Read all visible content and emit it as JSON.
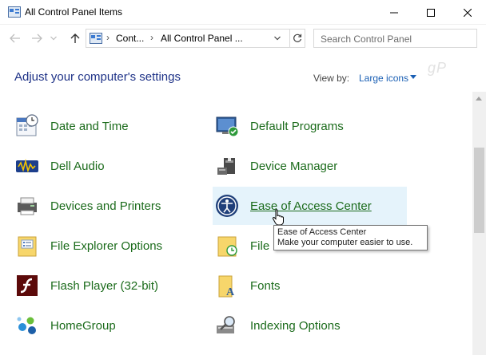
{
  "window": {
    "title": "All Control Panel Items",
    "controls": [
      "minimize",
      "maximize",
      "close"
    ]
  },
  "nav": {
    "address_crumbs": [
      "Cont...",
      "All Control Panel ..."
    ],
    "search_placeholder": "Search Control Panel",
    "watermark": "gP"
  },
  "header": {
    "title": "Adjust your computer's settings",
    "view_by_label": "View by:",
    "view_by_value": "Large icons"
  },
  "items": [
    {
      "label": "Date and Time",
      "icon": "calendar-clock-icon"
    },
    {
      "label": "Default Programs",
      "icon": "default-programs-icon"
    },
    {
      "label": "Dell Audio",
      "icon": "audio-icon"
    },
    {
      "label": "Device Manager",
      "icon": "device-manager-icon"
    },
    {
      "label": "Devices and Printers",
      "icon": "printer-icon"
    },
    {
      "label": "Ease of Access Center",
      "icon": "ease-of-access-icon"
    },
    {
      "label": "File Explorer Options",
      "icon": "folder-options-icon"
    },
    {
      "label": "File",
      "icon": "file-history-icon"
    },
    {
      "label": "Flash Player (32-bit)",
      "icon": "flash-icon"
    },
    {
      "label": "Fonts",
      "icon": "fonts-folder-icon"
    },
    {
      "label": "HomeGroup",
      "icon": "homegroup-icon"
    },
    {
      "label": "Indexing Options",
      "icon": "indexing-icon"
    }
  ],
  "tooltip": {
    "title": "Ease of Access Center",
    "description": "Make your computer easier to use."
  },
  "colors": {
    "link_green": "#1b6b1b",
    "heading_blue": "#1e3287",
    "hover_bg": "#e5f3fb"
  }
}
